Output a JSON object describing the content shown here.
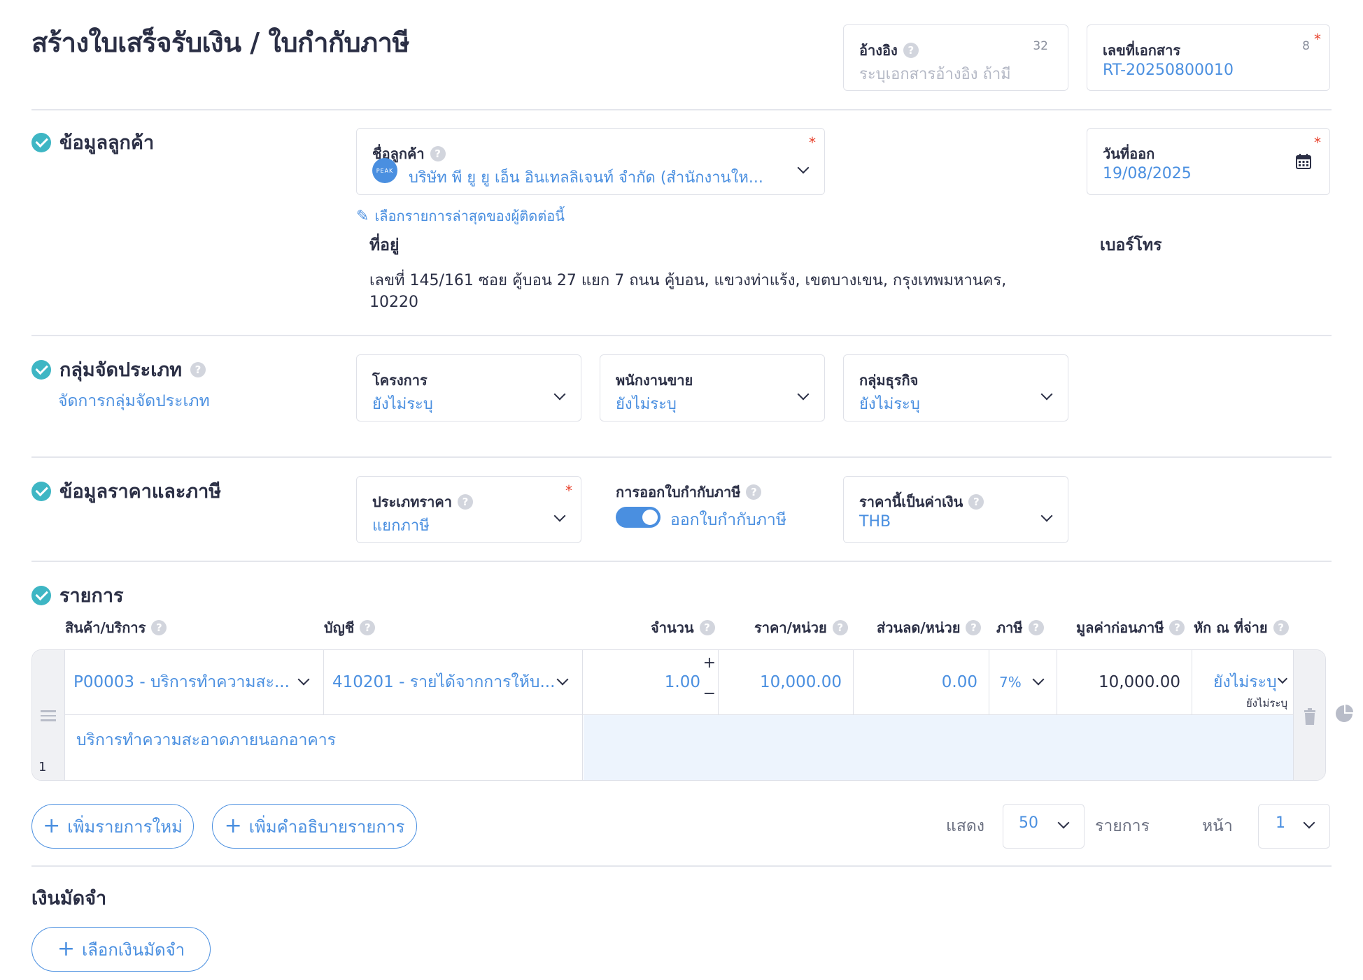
{
  "page": {
    "title": "สร้างใบเสร็จรับเงิน / ใบกำกับภาษี"
  },
  "reference": {
    "label": "อ้างอิง",
    "count": "32",
    "placeholder": "ระบุเอกสารอ้างอิง ถ้ามี"
  },
  "doc_number": {
    "label": "เลขที่เอกสาร",
    "count": "8",
    "value": "RT-20250800010"
  },
  "customer_section": {
    "title": "ข้อมูลลูกค้า",
    "customer_label": "ชื่อลูกค้า",
    "customer_value": "บริษัท พี ยู ยู เอ็น อินเทลลิเจนท์ จำกัด (สำนักงานให...",
    "avatar_text": "PEAK",
    "recent_link": "เลือกรายการล่าสุดของผู้ติดต่อนี้",
    "address_label": "ที่อยู่",
    "address_line1": "เลขที่ 145/161 ซอย คู้บอน 27 แยก 7 ถนน คู้บอน, แขวงท่าแร้ง, เขตบางเขน, กรุงเทพมหานคร,",
    "address_line2": "10220",
    "phone_label": "เบอร์โทร",
    "issue_date_label": "วันที่ออก",
    "issue_date_value": "19/08/2025"
  },
  "classification": {
    "title": "กลุ่มจัดประเภท",
    "manage_link": "จัดการกลุ่มจัดประเภท",
    "project_label": "โครงการ",
    "project_value": "ยังไม่ระบุ",
    "salesperson_label": "พนักงานขาย",
    "salesperson_value": "ยังไม่ระบุ",
    "business_label": "กลุ่มธุรกิจ",
    "business_value": "ยังไม่ระบุ"
  },
  "pricing": {
    "title": "ข้อมูลราคาและภาษี",
    "price_type_label": "ประเภทราคา",
    "price_type_value": "แยกภาษี",
    "tax_invoice_label": "การออกใบกำกับภาษี",
    "tax_invoice_value": "ออกใบกำกับภาษี",
    "tax_invoice_on": true,
    "currency_label": "ราคานี้เป็นค่าเงิน",
    "currency_value": "THB"
  },
  "items": {
    "title": "รายการ",
    "columns": {
      "product": "สินค้า/บริการ",
      "account": "บัญชี",
      "qty": "จำนวน",
      "unit_price": "ราคา/หน่วย",
      "discount": "ส่วนลด/หน่วย",
      "tax": "ภาษี",
      "pre_tax": "มูลค่าก่อนภาษี",
      "withholding": "หัก ณ ที่จ่าย"
    },
    "rows": [
      {
        "no": "1",
        "product": "P00003 - บริการทำความสะ...",
        "account": "410201 - รายได้จากการให้บ...",
        "qty": "1.00",
        "unit_price": "10,000.00",
        "discount": "0.00",
        "tax": "7%",
        "pre_tax": "10,000.00",
        "withholding": "ยังไม่ระบุ",
        "withholding_sub": "ยังไม่ระบุ",
        "description": "บริการทำความสะอาดภายนอกอาคาร"
      }
    ],
    "add_item": "เพิ่มรายการใหม่",
    "add_desc": "เพิ่มคำอธิบายรายการ",
    "show_label": "แสดง",
    "page_size": "50",
    "items_label": "รายการ",
    "page_label": "หน้า",
    "page_value": "1"
  },
  "deposit": {
    "title": "เงินมัดจำ",
    "select_button": "เลือกเงินมัดจำ"
  },
  "colors": {
    "accent": "#4a8fe0",
    "check": "#3eb6c4",
    "required": "#e8412b",
    "highlight": "#edf4fd"
  }
}
